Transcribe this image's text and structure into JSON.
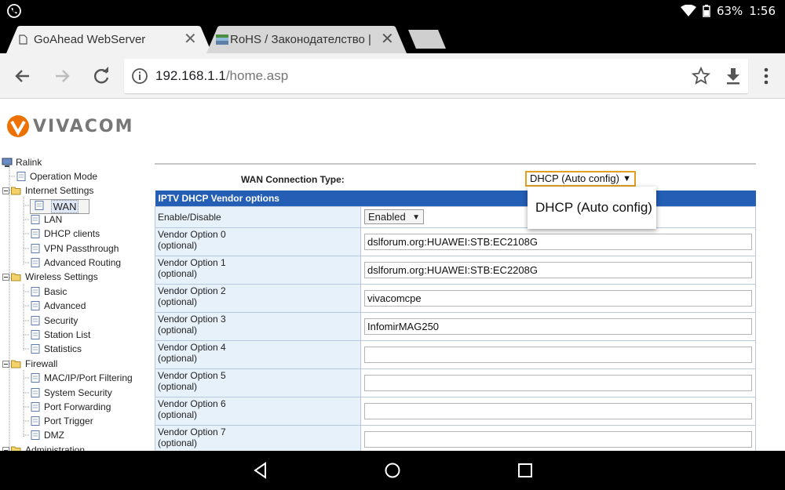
{
  "status_bar": {
    "battery": "63%",
    "time": "1:56"
  },
  "tabs": [
    {
      "title": "GoAhead WebServer",
      "active": true
    },
    {
      "title": "RoHS / Законодателство | Fa",
      "active": false
    }
  ],
  "toolbar": {
    "url_host": "192.168.1.1",
    "url_path": "/home.asp"
  },
  "logo": {
    "text": "VIVACOM"
  },
  "tree": {
    "root": "Ralink",
    "operation_mode": "Operation Mode",
    "internet_settings": "Internet Settings",
    "wan": "WAN",
    "lan": "LAN",
    "dhcp_clients": "DHCP clients",
    "vpn_passthrough": "VPN Passthrough",
    "advanced_routing": "Advanced Routing",
    "wireless_settings": "Wireless Settings",
    "basic": "Basic",
    "advanced": "Advanced",
    "security": "Security",
    "station_list": "Station List",
    "statistics": "Statistics",
    "firewall": "Firewall",
    "mac_ip_port_filtering": "MAC/IP/Port Filtering",
    "system_security": "System Security",
    "port_forwarding": "Port Forwarding",
    "port_trigger": "Port Trigger",
    "dmz": "DMZ",
    "administration": "Administration"
  },
  "form": {
    "wan_label": "WAN Connection Type:",
    "wan_value": "DHCP (Auto config)",
    "section_title": "IPTV DHCP Vendor options",
    "enable_label": "Enable/Disable",
    "enable_value": "Enabled",
    "rows": [
      {
        "label": "Vendor Option 0",
        "sub": "(optional)",
        "value": "dslforum.org:HUAWEI:STB:EC2108G"
      },
      {
        "label": "Vendor Option 1",
        "sub": "(optional)",
        "value": "dslforum.org:HUAWEI:STB:EC2208G"
      },
      {
        "label": "Vendor Option 2",
        "sub": "(optional)",
        "value": "vivacomcpe"
      },
      {
        "label": "Vendor Option 3",
        "sub": "(optional)",
        "value": "InfomirMAG250"
      },
      {
        "label": "Vendor Option 4",
        "sub": "(optional)",
        "value": ""
      },
      {
        "label": "Vendor Option 5",
        "sub": "(optional)",
        "value": ""
      },
      {
        "label": "Vendor Option 6",
        "sub": "(optional)",
        "value": ""
      },
      {
        "label": "Vendor Option 7",
        "sub": "(optional)",
        "value": ""
      }
    ]
  },
  "dropdown_popup": {
    "option": "DHCP (Auto config)"
  },
  "colors": {
    "table_header": "#245eb5",
    "label_cell": "#e6f1fa",
    "vivacom_orange": "#ee7203",
    "select_focus": "#e0a020"
  }
}
